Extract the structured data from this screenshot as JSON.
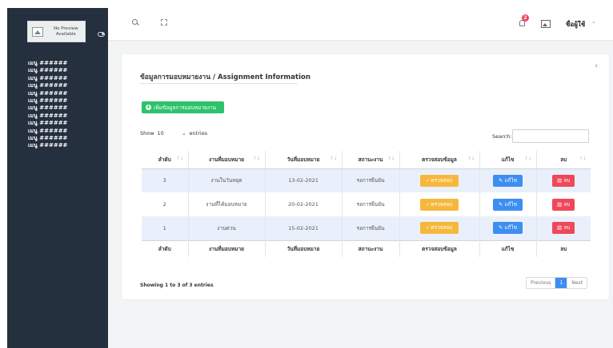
{
  "sidebar": {
    "logo_text": "No Preview Available",
    "menu": [
      "เมนู ######",
      "เมนู ######",
      "เมนู ######",
      "เมนู ######",
      "เมนู ######",
      "เมนู ######",
      "เมนู ######",
      "เมนู ######",
      "เมนู ######",
      "เมนู ######",
      "เมนู ######",
      "เมนู ######"
    ]
  },
  "header": {
    "notification_count": "2",
    "username": "ชื่อผู้ใช้"
  },
  "page": {
    "title": "ข้อมูลการมอบหมายงาน / Assignment Information",
    "add_button": "เพิ่มข้อมูลการมอบหมายงาน"
  },
  "table_controls": {
    "show_label": "Show",
    "entries_value": "10",
    "entries_label": "entries",
    "search_label": "Search:",
    "search_value": ""
  },
  "table": {
    "columns": [
      "ลำดับ",
      "งานที่มอบหมาย",
      "วันที่มอบหมาย",
      "สถานะงาน",
      "ตรวจสอบข้อมูล",
      "แก้ไข",
      "ลบ"
    ],
    "rows": [
      {
        "no": "3",
        "task": "งานในวันหยุด",
        "date": "13-02-2021",
        "status": "รอการยืนยัน",
        "check": "ตรวจสอบ",
        "edit": "แก้ไข",
        "delete": "ลบ"
      },
      {
        "no": "2",
        "task": "งานที่ได้มอบหมาย",
        "date": "20-02-2021",
        "status": "รอการยืนยัน",
        "check": "ตรวจสอบ",
        "edit": "แก้ไข",
        "delete": "ลบ"
      },
      {
        "no": "1",
        "task": "งานด่วน",
        "date": "15-02-2021",
        "status": "รอการยืนยัน",
        "check": "ตรวจสอบ",
        "edit": "แก้ไข",
        "delete": "ลบ"
      }
    ]
  },
  "footer": {
    "info": "Showing 1 to 3 of 3 entries",
    "previous": "Previous",
    "current_page": "1",
    "next": "Next"
  },
  "colors": {
    "sidebar": "#25303e",
    "add_button": "#2dc26b",
    "check_button": "#f6b83c",
    "edit_button": "#3d8ef0",
    "delete_button": "#f0475a",
    "row_stripe": "#eaf0fb"
  }
}
